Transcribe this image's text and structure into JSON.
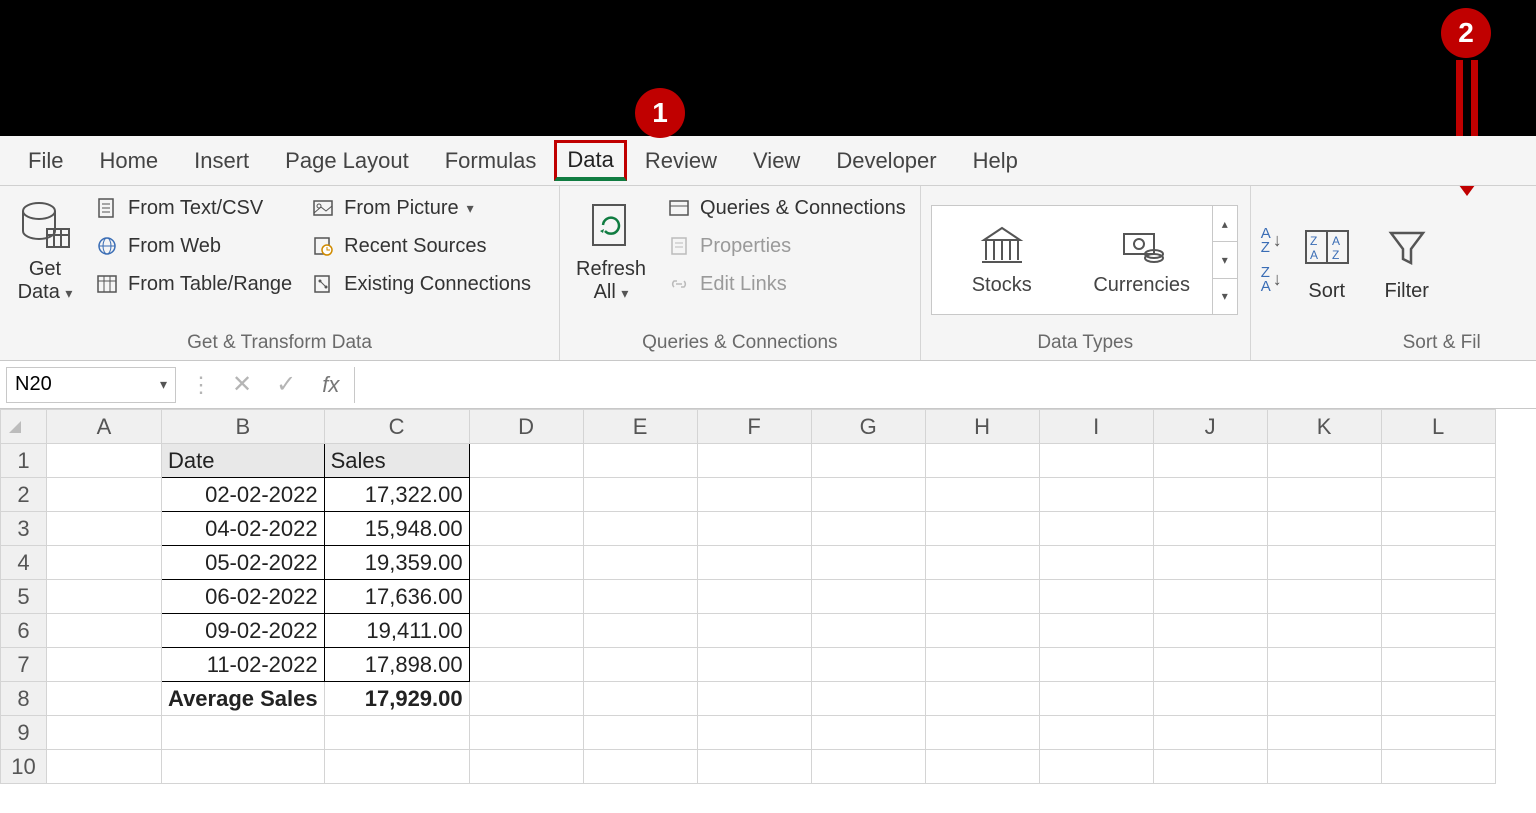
{
  "callouts": {
    "one": "1",
    "two": "2"
  },
  "tabs": {
    "file": "File",
    "home": "Home",
    "insert": "Insert",
    "pagelayout": "Page Layout",
    "formulas": "Formulas",
    "data": "Data",
    "review": "Review",
    "view": "View",
    "developer": "Developer",
    "help": "Help"
  },
  "ribbon": {
    "getdata": "Get\nData ˅",
    "getdata_line1": "Get",
    "getdata_line2": "Data",
    "fromtext": "From Text/CSV",
    "fromweb": "From Web",
    "fromtable": "From Table/Range",
    "frompicture": "From Picture",
    "recent": "Recent Sources",
    "existing": "Existing Connections",
    "group1": "Get & Transform Data",
    "refresh_line1": "Refresh",
    "refresh_line2": "All",
    "queries": "Queries & Connections",
    "properties": "Properties",
    "editlinks": "Edit Links",
    "group2": "Queries & Connections",
    "stocks": "Stocks",
    "currencies": "Currencies",
    "group3": "Data Types",
    "sort": "Sort",
    "filter": "Filter",
    "group4": "Sort & Fil"
  },
  "formulaBar": {
    "nameBox": "N20",
    "fx": "fx"
  },
  "columns": [
    "A",
    "B",
    "C",
    "D",
    "E",
    "F",
    "G",
    "H",
    "I",
    "J",
    "K",
    "L"
  ],
  "rows": [
    "1",
    "2",
    "3",
    "4",
    "5",
    "6",
    "7",
    "8",
    "9",
    "10"
  ],
  "table": {
    "headers": {
      "date": "Date",
      "sales": "Sales"
    },
    "data": [
      {
        "date": "02-02-2022",
        "sales": "17,322.00"
      },
      {
        "date": "04-02-2022",
        "sales": "15,948.00"
      },
      {
        "date": "05-02-2022",
        "sales": "19,359.00"
      },
      {
        "date": "06-02-2022",
        "sales": "17,636.00"
      },
      {
        "date": "09-02-2022",
        "sales": "19,411.00"
      },
      {
        "date": "11-02-2022",
        "sales": "17,898.00"
      }
    ],
    "footer": {
      "label": "Average Sales",
      "value": "17,929.00"
    }
  }
}
